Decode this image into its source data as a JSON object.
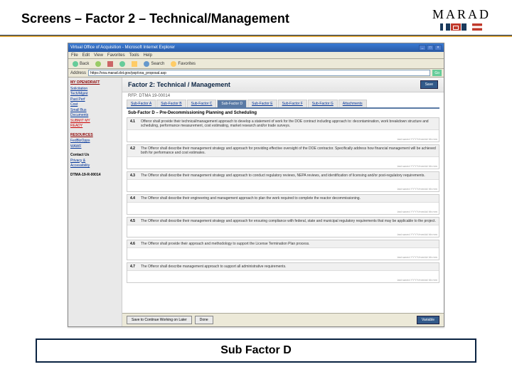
{
  "slide": {
    "title": "Screens – Factor 2 – Technical/Management",
    "brand": "MARAD",
    "caption": "Sub Factor D"
  },
  "window": {
    "title": "Virtual Office of Acquisition - Microsoft Internet Explorer",
    "menu": [
      "File",
      "Edit",
      "View",
      "Favorites",
      "Tools",
      "Help"
    ],
    "back": "Back",
    "address_label": "Address",
    "address_value": "https://voa.marad.dot.gov/psp/voa_proposal.asp",
    "go": "Go"
  },
  "sidebar": {
    "block1_title": "MY OPEN/DRAFT",
    "block1_links": [
      "Solicitation",
      "Tech/Mgmt",
      "Past Perf",
      "Cost",
      "Small Bus",
      "Documents"
    ],
    "block1_red": [
      "SUBMIT MY",
      "READY"
    ],
    "block2_title": "RESOURCES",
    "block2_links": [
      "FedBizOpps",
      "WAWF"
    ],
    "block3_title": "Contact Us",
    "block3_links": [
      "Privacy &",
      "Accessibility"
    ],
    "block4": "DTMA-19-R-00014"
  },
  "main": {
    "heading": "Factor 2: Technical / Management",
    "save_top": "Save",
    "rfp": "RFP: DTMA 19-00014",
    "tabs": [
      "Sub-Factor A",
      "Sub-Factor B",
      "Sub-Factor C",
      "Sub-Factor D",
      "Sub-Factor E",
      "Sub-Factor F",
      "Sub-Factor G",
      "Attachments"
    ],
    "active_tab": 3,
    "section_label": "Sub-Factor D – Pre-Decommissioning Planning and Scheduling",
    "save_note": "last saved YYYY/mm/dd hh:mm",
    "items": [
      {
        "num": "4.1",
        "text": "Offeror shall provide their technical/management approach to develop a statement of work for the DOE contract including approach to: decontamination, work breakdown structure and scheduling, performance measurement, cost estimating, market research and/or trade surveys."
      },
      {
        "num": "4.2",
        "text": "The Offeror shall describe their management strategy and approach for providing effective oversight of the DOE contractor. Specifically address how financial management will be achieved both for performance and cost estimates."
      },
      {
        "num": "4.3",
        "text": "The Offeror shall describe their management strategy and approach to conduct regulatory reviews, NEPA reviews, and identification of licensing and/or post-regulatory requirements."
      },
      {
        "num": "4.4",
        "text": "The Offeror shall describe their engineering and management approach to plan the work required to complete the reactor decommissioning."
      },
      {
        "num": "4.5",
        "text": "The Offeror shall describe their management strategy and approach for ensuring compliance with federal, state and municipal regulatory requirements that may be applicable to the project."
      },
      {
        "num": "4.6",
        "text": "The Offeror shall provide their approach and methodology to support the License Termination Plan process."
      },
      {
        "num": "4.7",
        "text": "The Offeror shall describe management approach to support all administrative requirements."
      }
    ],
    "btn_save_cont": "Save to Continue Working on Later",
    "btn_done": "Done",
    "btn_variable": "Variable"
  }
}
